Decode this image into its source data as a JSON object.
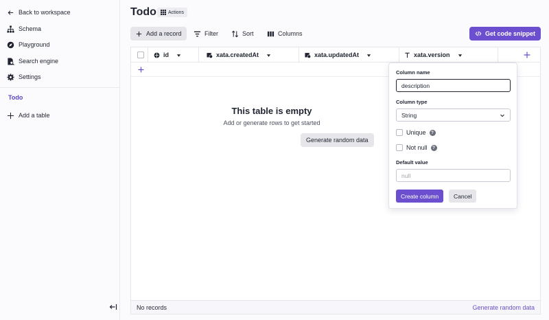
{
  "sidebar": {
    "back_label": "Back to workspace",
    "items": [
      {
        "label": "Schema",
        "icon": "sitemap-icon"
      },
      {
        "label": "Playground",
        "icon": "compass-icon"
      },
      {
        "label": "Search engine",
        "icon": "document-search-icon"
      },
      {
        "label": "Settings",
        "icon": "gear-icon"
      }
    ],
    "active_table": "Todo",
    "add_table_label": "Add a table"
  },
  "header": {
    "title": "Todo",
    "actions_label": "Actions"
  },
  "toolbar": {
    "add_record": "Add a record",
    "filter": "Filter",
    "sort": "Sort",
    "columns": "Columns",
    "snippet": "Get code snippet"
  },
  "table": {
    "columns": [
      {
        "label": "id",
        "icon": "id-icon"
      },
      {
        "label": "xata.createdAt",
        "icon": "calendar-clock-icon"
      },
      {
        "label": "xata.updatedAt",
        "icon": "calendar-clock-icon"
      },
      {
        "label": "xata.version",
        "icon": "text-type-icon"
      }
    ],
    "empty_title": "This table is empty",
    "empty_subtitle": "Add or generate rows to get started",
    "generate_label": "Generate random data",
    "footer_count": "No records",
    "footer_generate": "Generate random data"
  },
  "popover": {
    "name_label": "Column name",
    "name_value": "description",
    "type_label": "Column type",
    "type_value": "String",
    "unique_label": "Unique",
    "notnull_label": "Not null",
    "default_label": "Default value",
    "default_placeholder": "null",
    "create_label": "Create column",
    "cancel_label": "Cancel"
  },
  "colors": {
    "accent": "#6b4fcf",
    "active_text": "#5b44c2"
  }
}
